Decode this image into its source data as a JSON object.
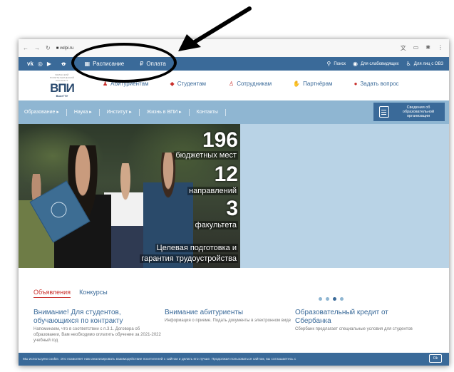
{
  "browser": {
    "nav_icons": [
      "back-icon",
      "forward-icon",
      "reload-icon"
    ],
    "url": "■ volpi.ru",
    "right_icons": [
      "translate-icon",
      "tabs-icon",
      "extensions-icon",
      "menu-icon"
    ]
  },
  "topbar": {
    "social": [
      "vk-icon",
      "instagram-icon",
      "youtube-icon"
    ],
    "schedule_label": "Расписание",
    "payment_label": "Оплата",
    "search_label": "Поиск",
    "vision_label": "Для слабовидящих",
    "ovz_label": "Для лиц с ОВЗ"
  },
  "logo": {
    "small": "ВОЛЖСКИЙ ПОЛИТЕХНИЧЕСКИЙ ИНСТИТУТ",
    "big": "ВПИ",
    "sub": "ВолгГТУ"
  },
  "audience": [
    {
      "label": "Абитуриентам",
      "icon": "graduate-icon"
    },
    {
      "label": "Студентам",
      "icon": "mortarboard-icon"
    },
    {
      "label": "Сотрудникам",
      "icon": "person-icon"
    },
    {
      "label": "Партнёрам",
      "icon": "handshake-icon"
    },
    {
      "label": "Задать вопрос",
      "icon": "chat-icon"
    }
  ],
  "mainnav": {
    "items": [
      "Образование ▸",
      "Наука ▸",
      "Институт ▸",
      "Жизнь в ВПИ ▸",
      "Контакты"
    ],
    "org_info": "Сведения об образовательной организации"
  },
  "slider": {
    "stats": [
      {
        "num": "196",
        "label": "бюджетных мест"
      },
      {
        "num": "12",
        "label": "направлений"
      },
      {
        "num": "3",
        "label": "факультета"
      }
    ],
    "promo_line1": "Целевая подготовка и",
    "promo_line2": "гарантия трудоустройства",
    "dots": 4,
    "active_dot": 3
  },
  "news": {
    "tabs": [
      "Объявления",
      "Конкурсы"
    ],
    "items": [
      {
        "title": "Внимание! Для студентов, обучающихся по контракту",
        "desc": "Напоминаем, что в соответствии с п.3.1. Договора об образовании, Вам необходимо оплатить обучение за 2021-2022 учебный год"
      },
      {
        "title": "Внимание абитуриенты",
        "desc": "Информация о приеме. Подать документы в электронном виде"
      },
      {
        "title": "Образовательный кредит от Сбербанка",
        "desc": "Сбербанк предлагает специальные условия для студентов"
      }
    ]
  },
  "cookie": {
    "text": "Мы используем cookie. Это позволяет нам анализировать взаимодействие посетителей с сайтом и делать его лучше. Продолжая пользоваться сайтом, вы соглашаетесь с",
    "ok": "Ok"
  },
  "colors": {
    "brand": "#3a6a99",
    "nav": "#8fb6d2",
    "accent": "#c9302c"
  }
}
